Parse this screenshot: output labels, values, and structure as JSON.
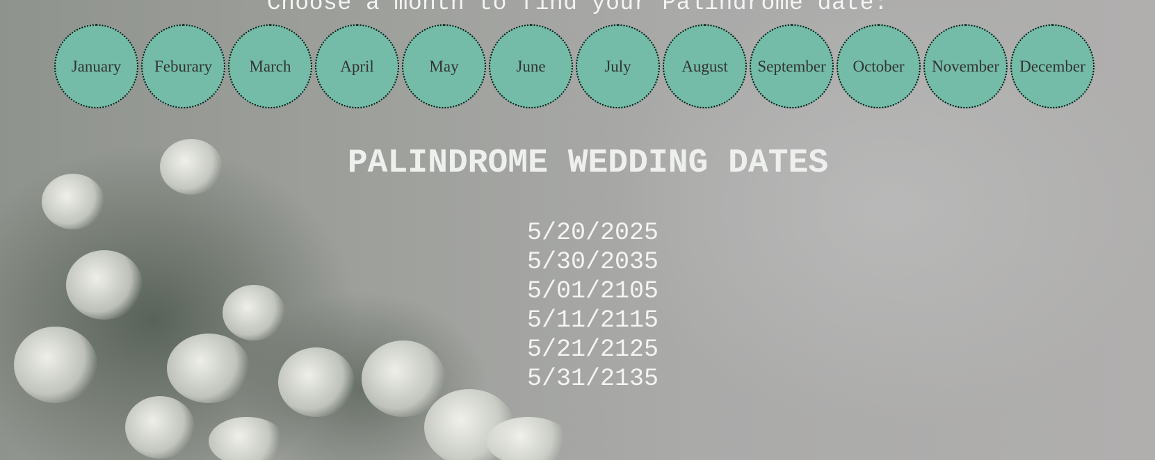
{
  "prompt": "Choose a month to find your Palindrome date:",
  "months": [
    {
      "label": "January"
    },
    {
      "label": "Feburary"
    },
    {
      "label": "March"
    },
    {
      "label": "April"
    },
    {
      "label": "May"
    },
    {
      "label": "June"
    },
    {
      "label": "July"
    },
    {
      "label": "August"
    },
    {
      "label": "September"
    },
    {
      "label": "October"
    },
    {
      "label": "November"
    },
    {
      "label": "December"
    }
  ],
  "title": "PALINDROME WEDDING DATES",
  "dates": [
    "5/20/2025",
    "5/30/2035",
    "5/01/2105",
    "5/11/2115",
    "5/21/2125",
    "5/31/2135"
  ],
  "colors": {
    "month_circle": "#74bca8",
    "text_light": "#f4f4f4"
  }
}
